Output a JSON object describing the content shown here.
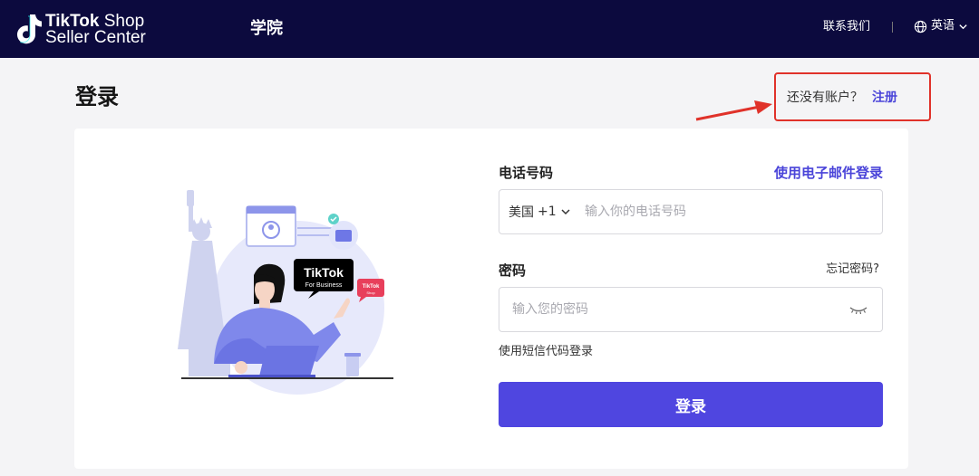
{
  "header": {
    "logo_line1_bold": "TikTok",
    "logo_line1_light": " Shop",
    "logo_line2": "Seller Center",
    "academy": "学院",
    "contact": "联系我们",
    "language": "英语",
    "bg_color": "#0c0a3e"
  },
  "page": {
    "title": "登录"
  },
  "signup": {
    "question": "还没有账户？",
    "link": "注册",
    "highlight_color": "#e0322a"
  },
  "form": {
    "phone_label": "电话号码",
    "email_login_link": "使用电子邮件登录",
    "country_name": "美国",
    "country_code": "+1",
    "phone_placeholder": "输入你的电话号码",
    "password_label": "密码",
    "forgot_link": "忘记密码?",
    "password_placeholder": "输入您的密码",
    "sms_login_link": "使用短信代码登录",
    "submit_label": "登录",
    "accent_color": "#4f46e0"
  },
  "illustration": {
    "badge_main": "TikTok",
    "badge_sub": "For Business",
    "badge_small": "TikTok",
    "badge_small_sub": "Shop"
  }
}
